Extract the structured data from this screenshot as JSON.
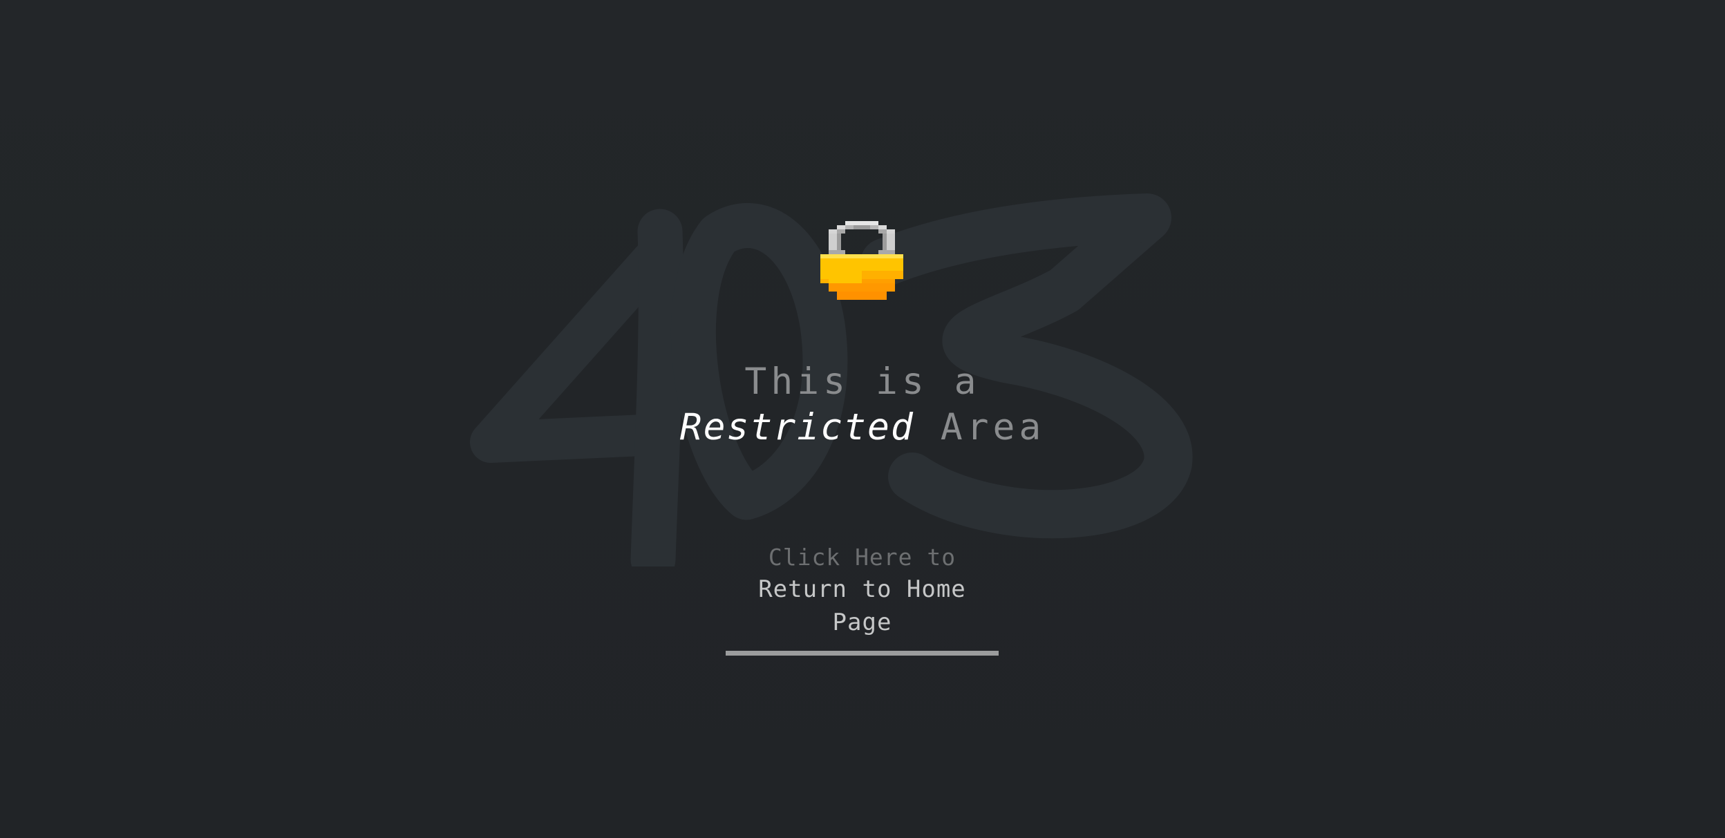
{
  "background_code": "403",
  "icon": "padlock-pixel",
  "colors": {
    "background": "#222528",
    "watermark": "#2b3034",
    "lock_shackle": "#c7c7c7",
    "lock_body_top": "#ffc400",
    "lock_body_bottom": "#ff9800"
  },
  "headline": {
    "line1": "This is a",
    "emphasis": "Restricted",
    "rest": "Area"
  },
  "cta": {
    "prefix": "Click Here to",
    "label": "Return to Home Page"
  }
}
